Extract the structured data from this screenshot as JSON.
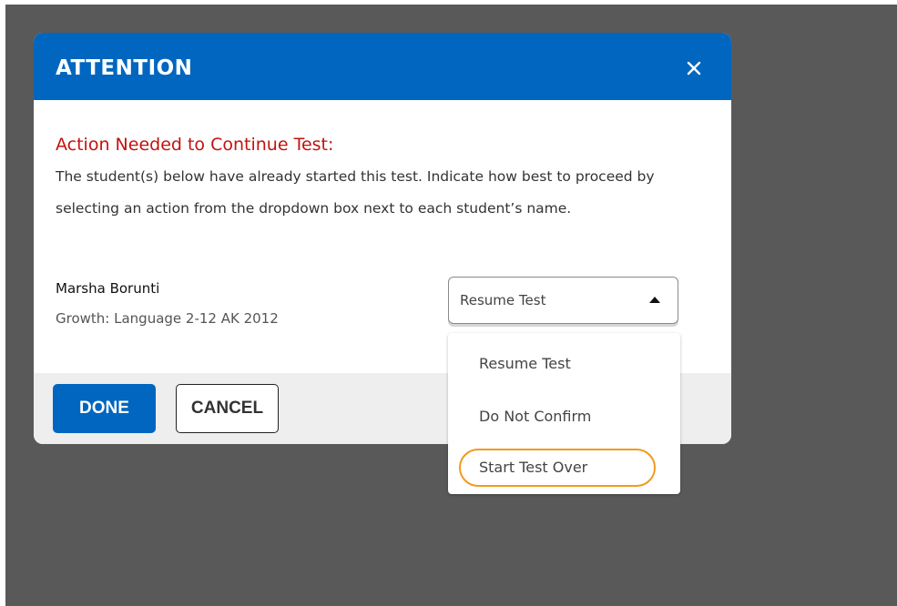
{
  "dialog": {
    "title": "ATTENTION",
    "close_label": "×",
    "heading": "Action Needed to Continue Test:",
    "instructions": "The student(s) below have already started this test. Indicate how best to proceed by selecting an action from the dropdown box next to each student’s name."
  },
  "student": {
    "name": "Marsha Borunti",
    "test": "Growth: Language 2-12 AK 2012"
  },
  "select": {
    "value": "Resume Test",
    "options": [
      {
        "label": "Resume Test"
      },
      {
        "label": "Do Not Confirm"
      },
      {
        "label": "Start Test Over"
      }
    ],
    "highlighted_option": "Start Test Over"
  },
  "footer": {
    "done_label": "DONE",
    "cancel_label": "CANCEL"
  },
  "colors": {
    "header_blue": "#0066bf",
    "heading_red": "#c4120f",
    "highlight_orange": "#f29a1d",
    "backdrop_gray": "#595959"
  }
}
